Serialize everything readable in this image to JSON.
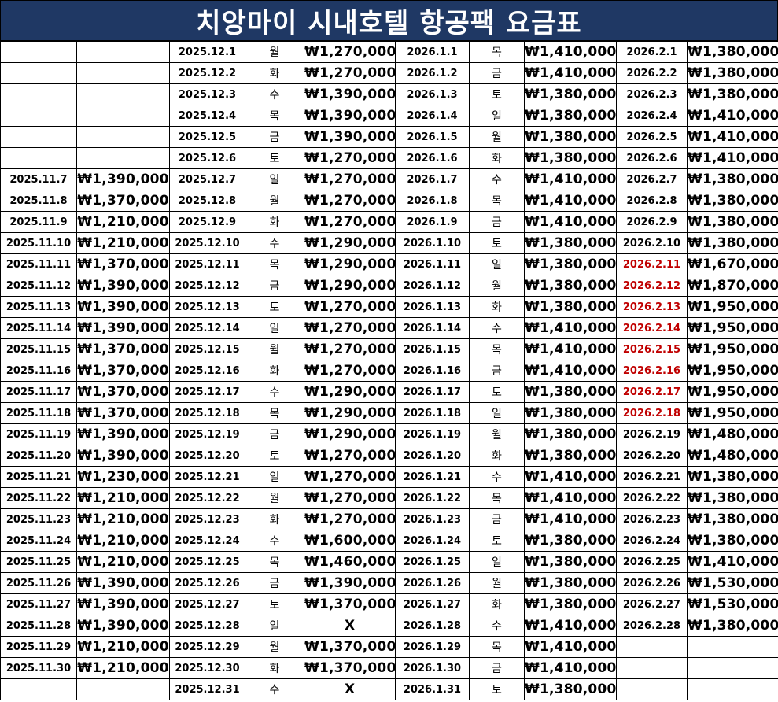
{
  "title": "치앙마이 시내호텔 항공팩 요금표",
  "highlight_color": "#c00000",
  "header_color": "#1f3864",
  "november": [
    {
      "date": "2025.11.7",
      "price": "₩1,390,000"
    },
    {
      "date": "2025.11.8",
      "price": "₩1,370,000"
    },
    {
      "date": "2025.11.9",
      "price": "₩1,210,000"
    },
    {
      "date": "2025.11.10",
      "price": "₩1,210,000"
    },
    {
      "date": "2025.11.11",
      "price": "₩1,370,000"
    },
    {
      "date": "2025.11.12",
      "price": "₩1,390,000"
    },
    {
      "date": "2025.11.13",
      "price": "₩1,390,000"
    },
    {
      "date": "2025.11.14",
      "price": "₩1,390,000"
    },
    {
      "date": "2025.11.15",
      "price": "₩1,370,000"
    },
    {
      "date": "2025.11.16",
      "price": "₩1,370,000"
    },
    {
      "date": "2025.11.17",
      "price": "₩1,370,000"
    },
    {
      "date": "2025.11.18",
      "price": "₩1,370,000"
    },
    {
      "date": "2025.11.19",
      "price": "₩1,390,000"
    },
    {
      "date": "2025.11.20",
      "price": "₩1,390,000"
    },
    {
      "date": "2025.11.21",
      "price": "₩1,230,000"
    },
    {
      "date": "2025.11.22",
      "price": "₩1,210,000"
    },
    {
      "date": "2025.11.23",
      "price": "₩1,210,000"
    },
    {
      "date": "2025.11.24",
      "price": "₩1,210,000"
    },
    {
      "date": "2025.11.25",
      "price": "₩1,210,000"
    },
    {
      "date": "2025.11.26",
      "price": "₩1,390,000"
    },
    {
      "date": "2025.11.27",
      "price": "₩1,390,000"
    },
    {
      "date": "2025.11.28",
      "price": "₩1,390,000"
    },
    {
      "date": "2025.11.29",
      "price": "₩1,210,000"
    },
    {
      "date": "2025.11.30",
      "price": "₩1,210,000"
    }
  ],
  "december": [
    {
      "date": "2025.12.1",
      "day": "월",
      "price": "₩1,270,000"
    },
    {
      "date": "2025.12.2",
      "day": "화",
      "price": "₩1,270,000"
    },
    {
      "date": "2025.12.3",
      "day": "수",
      "price": "₩1,390,000"
    },
    {
      "date": "2025.12.4",
      "day": "목",
      "price": "₩1,390,000"
    },
    {
      "date": "2025.12.5",
      "day": "금",
      "price": "₩1,390,000"
    },
    {
      "date": "2025.12.6",
      "day": "토",
      "price": "₩1,270,000"
    },
    {
      "date": "2025.12.7",
      "day": "일",
      "price": "₩1,270,000"
    },
    {
      "date": "2025.12.8",
      "day": "월",
      "price": "₩1,270,000"
    },
    {
      "date": "2025.12.9",
      "day": "화",
      "price": "₩1,270,000"
    },
    {
      "date": "2025.12.10",
      "day": "수",
      "price": "₩1,290,000"
    },
    {
      "date": "2025.12.11",
      "day": "목",
      "price": "₩1,290,000"
    },
    {
      "date": "2025.12.12",
      "day": "금",
      "price": "₩1,290,000"
    },
    {
      "date": "2025.12.13",
      "day": "토",
      "price": "₩1,270,000"
    },
    {
      "date": "2025.12.14",
      "day": "일",
      "price": "₩1,270,000"
    },
    {
      "date": "2025.12.15",
      "day": "월",
      "price": "₩1,270,000"
    },
    {
      "date": "2025.12.16",
      "day": "화",
      "price": "₩1,270,000"
    },
    {
      "date": "2025.12.17",
      "day": "수",
      "price": "₩1,290,000"
    },
    {
      "date": "2025.12.18",
      "day": "목",
      "price": "₩1,290,000"
    },
    {
      "date": "2025.12.19",
      "day": "금",
      "price": "₩1,290,000"
    },
    {
      "date": "2025.12.20",
      "day": "토",
      "price": "₩1,270,000"
    },
    {
      "date": "2025.12.21",
      "day": "일",
      "price": "₩1,270,000"
    },
    {
      "date": "2025.12.22",
      "day": "월",
      "price": "₩1,270,000"
    },
    {
      "date": "2025.12.23",
      "day": "화",
      "price": "₩1,270,000"
    },
    {
      "date": "2025.12.24",
      "day": "수",
      "price": "₩1,600,000"
    },
    {
      "date": "2025.12.25",
      "day": "목",
      "price": "₩1,460,000"
    },
    {
      "date": "2025.12.26",
      "day": "금",
      "price": "₩1,390,000"
    },
    {
      "date": "2025.12.27",
      "day": "토",
      "price": "₩1,370,000"
    },
    {
      "date": "2025.12.28",
      "day": "일",
      "price": "X"
    },
    {
      "date": "2025.12.29",
      "day": "월",
      "price": "₩1,370,000"
    },
    {
      "date": "2025.12.30",
      "day": "화",
      "price": "₩1,370,000"
    },
    {
      "date": "2025.12.31",
      "day": "수",
      "price": "X"
    }
  ],
  "january": [
    {
      "date": "2026.1.1",
      "day": "목",
      "price": "₩1,410,000"
    },
    {
      "date": "2026.1.2",
      "day": "금",
      "price": "₩1,410,000"
    },
    {
      "date": "2026.1.3",
      "day": "토",
      "price": "₩1,380,000"
    },
    {
      "date": "2026.1.4",
      "day": "일",
      "price": "₩1,380,000"
    },
    {
      "date": "2026.1.5",
      "day": "월",
      "price": "₩1,380,000"
    },
    {
      "date": "2026.1.6",
      "day": "화",
      "price": "₩1,380,000"
    },
    {
      "date": "2026.1.7",
      "day": "수",
      "price": "₩1,410,000"
    },
    {
      "date": "2026.1.8",
      "day": "목",
      "price": "₩1,410,000"
    },
    {
      "date": "2026.1.9",
      "day": "금",
      "price": "₩1,410,000"
    },
    {
      "date": "2026.1.10",
      "day": "토",
      "price": "₩1,380,000"
    },
    {
      "date": "2026.1.11",
      "day": "일",
      "price": "₩1,380,000"
    },
    {
      "date": "2026.1.12",
      "day": "월",
      "price": "₩1,380,000"
    },
    {
      "date": "2026.1.13",
      "day": "화",
      "price": "₩1,380,000"
    },
    {
      "date": "2026.1.14",
      "day": "수",
      "price": "₩1,410,000"
    },
    {
      "date": "2026.1.15",
      "day": "목",
      "price": "₩1,410,000"
    },
    {
      "date": "2026.1.16",
      "day": "금",
      "price": "₩1,410,000"
    },
    {
      "date": "2026.1.17",
      "day": "토",
      "price": "₩1,380,000"
    },
    {
      "date": "2026.1.18",
      "day": "일",
      "price": "₩1,380,000"
    },
    {
      "date": "2026.1.19",
      "day": "월",
      "price": "₩1,380,000"
    },
    {
      "date": "2026.1.20",
      "day": "화",
      "price": "₩1,380,000"
    },
    {
      "date": "2026.1.21",
      "day": "수",
      "price": "₩1,410,000"
    },
    {
      "date": "2026.1.22",
      "day": "목",
      "price": "₩1,410,000"
    },
    {
      "date": "2026.1.23",
      "day": "금",
      "price": "₩1,410,000"
    },
    {
      "date": "2026.1.24",
      "day": "토",
      "price": "₩1,380,000"
    },
    {
      "date": "2026.1.25",
      "day": "일",
      "price": "₩1,380,000"
    },
    {
      "date": "2026.1.26",
      "day": "월",
      "price": "₩1,380,000"
    },
    {
      "date": "2026.1.27",
      "day": "화",
      "price": "₩1,380,000"
    },
    {
      "date": "2026.1.28",
      "day": "수",
      "price": "₩1,410,000"
    },
    {
      "date": "2026.1.29",
      "day": "목",
      "price": "₩1,410,000"
    },
    {
      "date": "2026.1.30",
      "day": "금",
      "price": "₩1,410,000"
    },
    {
      "date": "2026.1.31",
      "day": "토",
      "price": "₩1,380,000"
    }
  ],
  "february": [
    {
      "date": "2026.2.1",
      "price": "₩1,380,000",
      "highlight": false
    },
    {
      "date": "2026.2.2",
      "price": "₩1,380,000",
      "highlight": false
    },
    {
      "date": "2026.2.3",
      "price": "₩1,380,000",
      "highlight": false
    },
    {
      "date": "2026.2.4",
      "price": "₩1,410,000",
      "highlight": false
    },
    {
      "date": "2026.2.5",
      "price": "₩1,410,000",
      "highlight": false
    },
    {
      "date": "2026.2.6",
      "price": "₩1,410,000",
      "highlight": false
    },
    {
      "date": "2026.2.7",
      "price": "₩1,380,000",
      "highlight": false
    },
    {
      "date": "2026.2.8",
      "price": "₩1,380,000",
      "highlight": false
    },
    {
      "date": "2026.2.9",
      "price": "₩1,380,000",
      "highlight": false
    },
    {
      "date": "2026.2.10",
      "price": "₩1,380,000",
      "highlight": false
    },
    {
      "date": "2026.2.11",
      "price": "₩1,670,000",
      "highlight": true
    },
    {
      "date": "2026.2.12",
      "price": "₩1,870,000",
      "highlight": true
    },
    {
      "date": "2026.2.13",
      "price": "₩1,950,000",
      "highlight": true
    },
    {
      "date": "2026.2.14",
      "price": "₩1,950,000",
      "highlight": true
    },
    {
      "date": "2026.2.15",
      "price": "₩1,950,000",
      "highlight": true
    },
    {
      "date": "2026.2.16",
      "price": "₩1,950,000",
      "highlight": true
    },
    {
      "date": "2026.2.17",
      "price": "₩1,950,000",
      "highlight": true
    },
    {
      "date": "2026.2.18",
      "price": "₩1,950,000",
      "highlight": true
    },
    {
      "date": "2026.2.19",
      "price": "₩1,480,000",
      "highlight": false
    },
    {
      "date": "2026.2.20",
      "price": "₩1,480,000",
      "highlight": false
    },
    {
      "date": "2026.2.21",
      "price": "₩1,380,000",
      "highlight": false
    },
    {
      "date": "2026.2.22",
      "price": "₩1,380,000",
      "highlight": false
    },
    {
      "date": "2026.2.23",
      "price": "₩1,380,000",
      "highlight": false
    },
    {
      "date": "2026.2.24",
      "price": "₩1,380,000",
      "highlight": false
    },
    {
      "date": "2026.2.25",
      "price": "₩1,410,000",
      "highlight": false
    },
    {
      "date": "2026.2.26",
      "price": "₩1,530,000",
      "highlight": false
    },
    {
      "date": "2026.2.27",
      "price": "₩1,530,000",
      "highlight": false
    },
    {
      "date": "2026.2.28",
      "price": "₩1,380,000",
      "highlight": false
    }
  ]
}
